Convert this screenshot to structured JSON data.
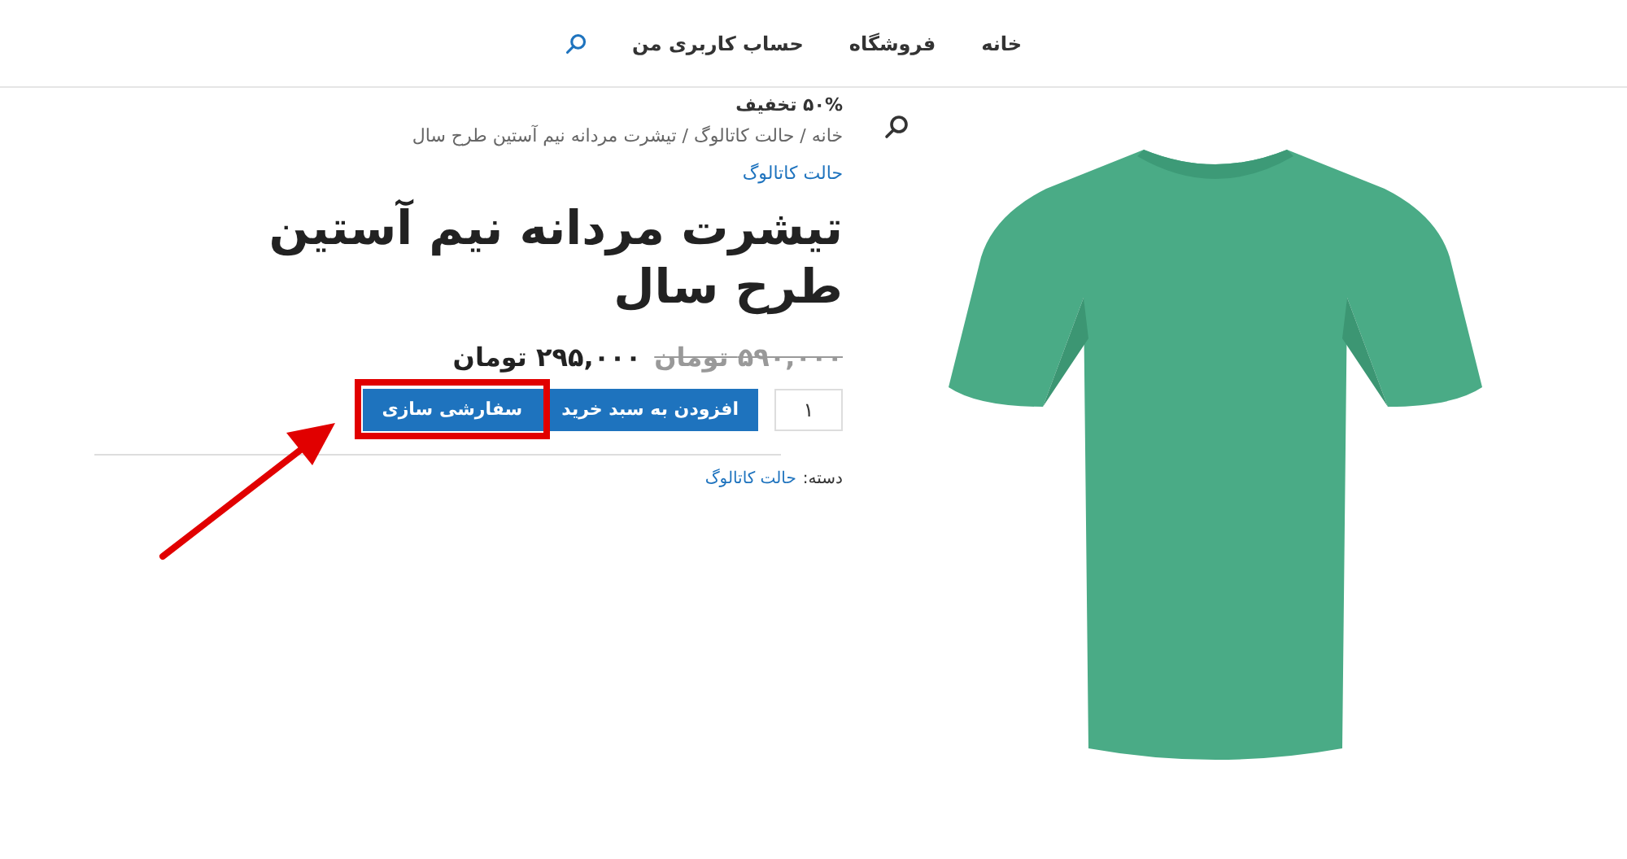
{
  "nav": {
    "items": [
      {
        "label": "خانه"
      },
      {
        "label": "فروشگاه"
      },
      {
        "label": "حساب کاربری من"
      }
    ]
  },
  "product": {
    "badge": "۵۰% تخفیف",
    "breadcrumb": "خانه / حالت کاتالوگ / تیشرت مردانه نیم آستین طرح سال",
    "category_link": "حالت کاتالوگ",
    "title": "تیشرت مردانه نیم آستین طرح سال",
    "old_price": "۵۹۰,۰۰۰ تومان",
    "price": "۲۹۵,۰۰۰ تومان",
    "quantity": "۱",
    "buttons": [
      {
        "label": "افزودن به سبد خرید",
        "highlighted": false
      },
      {
        "label": "سفارشی سازی",
        "highlighted": true
      }
    ],
    "meta_label": "دسته:",
    "meta_link": "حالت کاتالوگ"
  }
}
